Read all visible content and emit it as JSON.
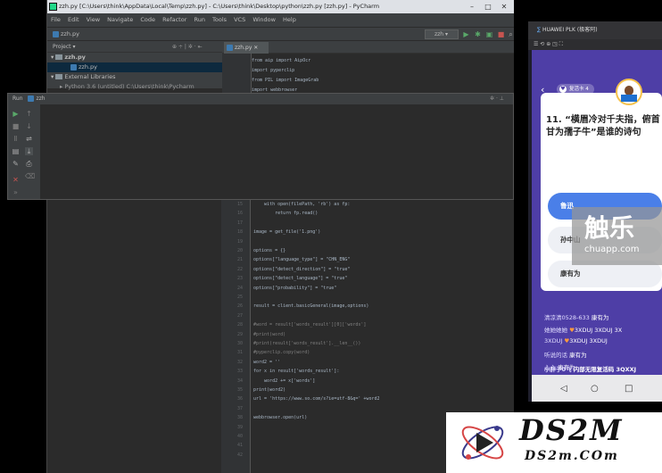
{
  "pycharm": {
    "title": "zzh.py [C:\\Users\\think\\AppData\\Local\\Temp\\zzh.py] - C:\\Users\\think\\Desktop\\python\\zzh.py [zzh.py] - PyCharm",
    "menu": [
      "File",
      "Edit",
      "View",
      "Navigate",
      "Code",
      "Refactor",
      "Run",
      "Tools",
      "VCS",
      "Window",
      "Help"
    ],
    "breadcrumb": "zzh.py",
    "run_config": "zzh",
    "project": {
      "header": "Project",
      "items": [
        "zzh.py",
        "zzh.py",
        "External Libraries",
        "Python 3.6 (untitled)  C:\\Users\\think\\Pycharm"
      ]
    },
    "editor_tab": "zzh.py",
    "run_panel": {
      "label": "Run",
      "config": "zzh"
    },
    "code_top": [
      {
        "ln": "",
        "text": "from aip import AipOcr"
      },
      {
        "ln": "",
        "text": "import pyperclip"
      },
      {
        "ln": "",
        "text": "from PIL import ImageGrab"
      },
      {
        "ln": "",
        "text": "import webbrowser"
      }
    ],
    "code_bottom": [
      {
        "ln": "15",
        "text": "    with open(filePath, 'rb') as fp:"
      },
      {
        "ln": "16",
        "text": "        return fp.read()"
      },
      {
        "ln": "17",
        "text": ""
      },
      {
        "ln": "18",
        "text": "image = get_file('1.png')"
      },
      {
        "ln": "19",
        "text": ""
      },
      {
        "ln": "20",
        "text": "options = {}"
      },
      {
        "ln": "21",
        "text": "options[\"language_type\"] = \"CHN_ENG\""
      },
      {
        "ln": "22",
        "text": "options[\"detect_direction\"] = \"true\""
      },
      {
        "ln": "23",
        "text": "options[\"detect_language\"] = \"true\""
      },
      {
        "ln": "24",
        "text": "options[\"probability\"] = \"true\""
      },
      {
        "ln": "25",
        "text": ""
      },
      {
        "ln": "26",
        "text": "result = client.basicGeneral(image,options)"
      },
      {
        "ln": "27",
        "text": ""
      },
      {
        "ln": "28",
        "text": "#word = result['words_result'][0]['words']"
      },
      {
        "ln": "29",
        "text": "#print(word)"
      },
      {
        "ln": "30",
        "text": "#print(result['words_result'].__len__())"
      },
      {
        "ln": "31",
        "text": "#pyperclip.copy(word)"
      },
      {
        "ln": "32",
        "text": "word2 = ''"
      },
      {
        "ln": "33",
        "text": "for x in result['words_result']:"
      },
      {
        "ln": "34",
        "text": "    word2 += x['words']"
      },
      {
        "ln": "35",
        "text": "print(word2)"
      },
      {
        "ln": "36",
        "text": "url = 'https://www.so.com/s?ie=utf-8&q=' +word2"
      },
      {
        "ln": "37",
        "text": ""
      },
      {
        "ln": "38",
        "text": "webbrowser.open(url)"
      },
      {
        "ln": "39",
        "text": ""
      },
      {
        "ln": "40",
        "text": ""
      },
      {
        "ln": "41",
        "text": ""
      },
      {
        "ln": "42",
        "text": ""
      }
    ]
  },
  "phone": {
    "window_title": "HUAWEI PLK (极客阿)",
    "resurrect_label": "复活卡 4",
    "question": "11. “横眉冷对千夫指，俯首甘为孺子牛”是谁的诗句",
    "options": [
      "鲁迅",
      "孙中山",
      "康有为"
    ],
    "chat": [
      {
        "name": "清凉清0528-633",
        "msg": "康有为"
      },
      {
        "name": "她她她她",
        "msg": "3XDUJ 3XDUJ 3X"
      },
      {
        "name": "3XDUJ",
        "msg": "3XDUJ 3XDUJ"
      },
      {
        "name": "听说的话",
        "msg": "康有为"
      },
      {
        "name": "心心",
        "msg": "康有为"
      },
      {
        "name": "小胖子0飞",
        "msg": "内部无限复活码  3QXXJ"
      }
    ]
  },
  "watermarks": {
    "chule": "触乐",
    "chule_url": "chuapp.com",
    "ds2m": "DS2M",
    "ds2m_url": "DS2m.COm"
  }
}
